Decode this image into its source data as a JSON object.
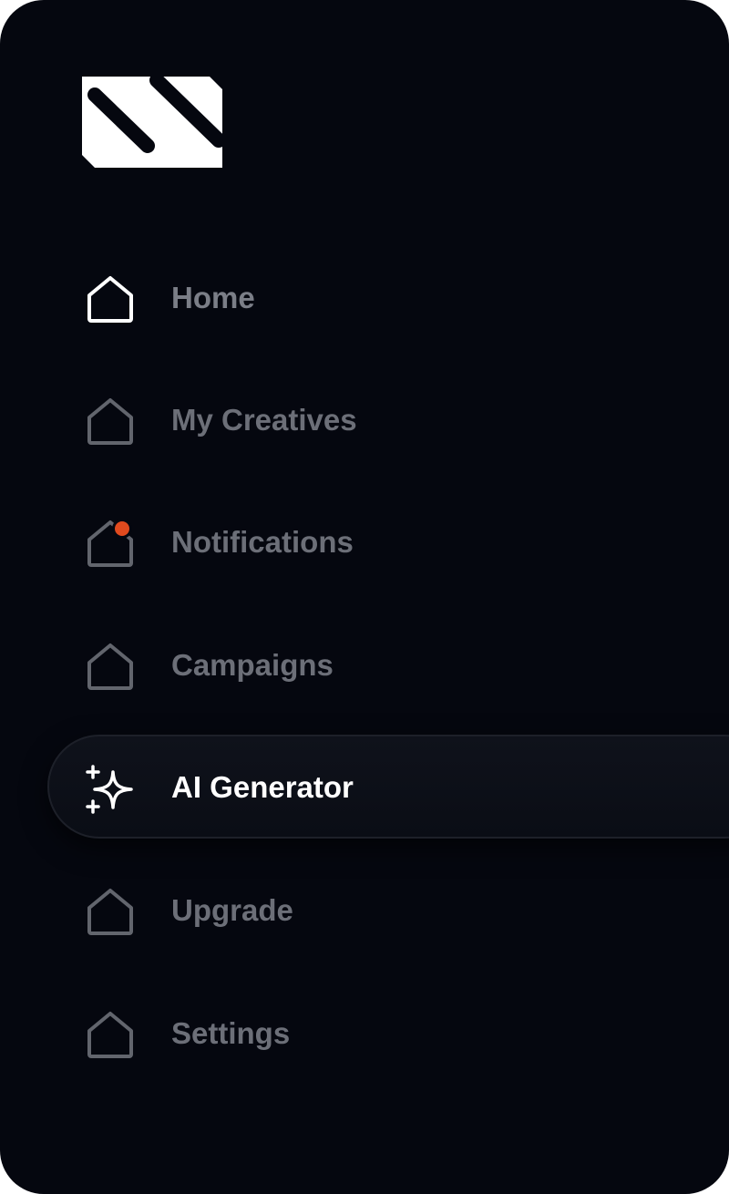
{
  "brand": {
    "logo_icon": "brand-logo-icon"
  },
  "colors": {
    "panel_background": "#05070f",
    "label_inactive": "#6c6f78",
    "label_active": "#ffffff",
    "notification_dot": "#e14a1e"
  },
  "nav": {
    "items": [
      {
        "label": "Home",
        "icon": "home-icon"
      },
      {
        "label": "My Creatives",
        "icon": "home-icon"
      },
      {
        "label": "Notifications",
        "icon": "home-icon",
        "badge": "notification-dot"
      },
      {
        "label": "Campaigns",
        "icon": "home-icon"
      },
      {
        "label": "AI Generator",
        "icon": "sparkles-icon",
        "active": true
      },
      {
        "label": "Upgrade",
        "icon": "home-icon"
      },
      {
        "label": "Settings",
        "icon": "home-icon"
      }
    ]
  }
}
